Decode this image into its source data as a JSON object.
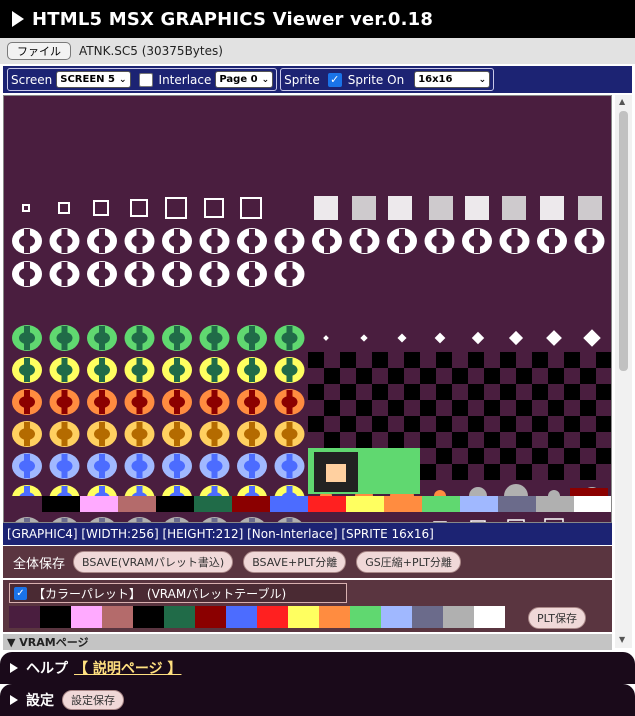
{
  "title": "HTML5 MSX GRAPHICS Viewer ver.0.18",
  "file": {
    "button_label": "ファイル",
    "name": "ATNK.SC5 (30375Bytes)"
  },
  "controls": {
    "screen_label": "Screen",
    "screen_value": "SCREEN 5",
    "interlace_label": "Interlace",
    "interlace_checked": false,
    "page_value": "Page 0",
    "sprite_label": "Sprite",
    "sprite_on_label": "Sprite On",
    "sprite_on_checked": true,
    "sprite_size_value": "16x16"
  },
  "info": "[GRAPHIC4] [WIDTH:256] [HEIGHT:212] [Non-Interlace] [SPRITE 16x16]",
  "save": {
    "label": "全体保存",
    "buttons": [
      "BSAVE(VRAMパレット書込)",
      "BSAVE+PLT分離",
      "GS圧縮+PLT分離"
    ]
  },
  "palette": {
    "title": "【カラーパレット】　(VRAMパレットテーブル)",
    "checked": true,
    "colors": [
      "#4a1e3f",
      "#000000",
      "#ffaaff",
      "#b46b6b",
      "#000000",
      "#206b48",
      "#8b0000",
      "#4c6cff",
      "#ff2020",
      "#ffff60",
      "#ff8c40",
      "#60d870",
      "#a0b8ff",
      "#6b6b8b",
      "#b0b0b0",
      "#ffffff"
    ],
    "save_button": "PLT保存"
  },
  "vram_section": "▼ VRAMページ",
  "help": {
    "title": "ヘルプ",
    "link": "【 説明ページ 】"
  },
  "settings": {
    "title": "設定",
    "button": "設定保存"
  },
  "sprite_palette": {
    "bg": "#4a1e3f",
    "rows": [
      [
        "#ffffff",
        "#ffffff"
      ],
      [
        "#60d870",
        "#206b48"
      ],
      [
        "#ffff60",
        "#206b48"
      ],
      [
        "#ff8c40",
        "#8b0000"
      ],
      [
        "#ffd060",
        "#b46b00"
      ],
      [
        "#a0b8ff",
        "#4c6cff"
      ],
      [
        "#ffff60",
        "#4c6cff"
      ],
      [
        "#b0b0b0",
        "#6b6b8b"
      ],
      [
        "#ffff60",
        "#b46b00"
      ]
    ]
  }
}
